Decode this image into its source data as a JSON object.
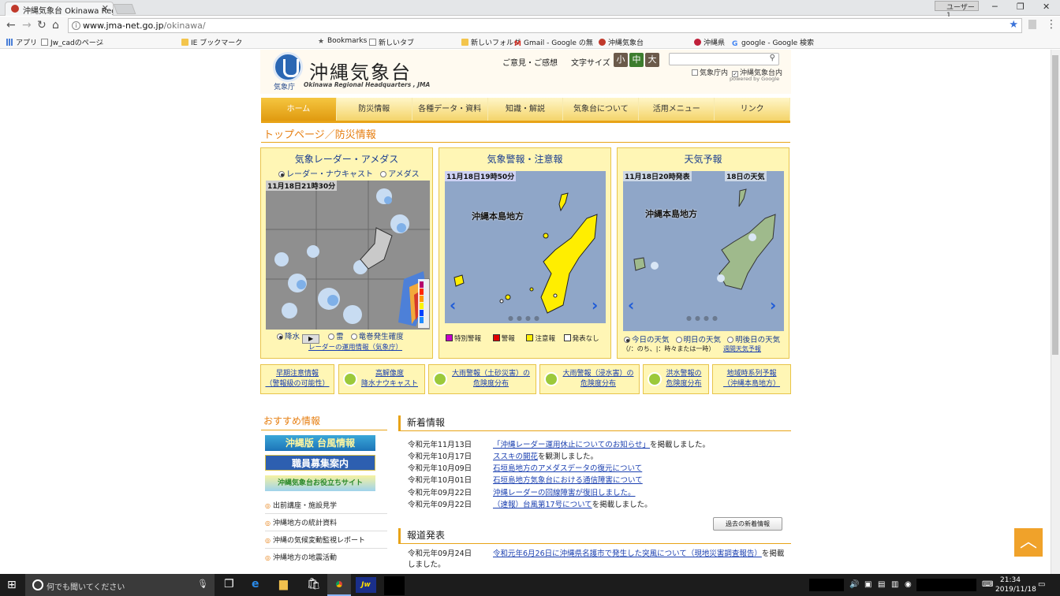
{
  "browser": {
    "tab_title": "沖縄気象台 Okinawa Reg",
    "user_label": "ユーザー 1",
    "url_host": "www.jma-net.go.jp",
    "url_path": "/okinawa/",
    "bookmarks": [
      "アプリ",
      "Jw_cadのページ",
      "_",
      "IE ブックマーク",
      "Bookmarks",
      "新しいタブ",
      "新しいフォルダ",
      "Gmail - Google の無料",
      "沖縄気象台",
      "沖縄県",
      "google - Google 検索"
    ]
  },
  "header": {
    "agency": "気象庁",
    "title": "沖縄気象台",
    "subtitle": "Okinawa Regional Headquarters , JMA",
    "feedback": "ご意見・ご感想",
    "fontsize_label": "文字サイズ",
    "fs_small": "小",
    "fs_medium": "中",
    "fs_large": "大",
    "scope_site": "気象庁内",
    "scope_local": "沖縄気象台内",
    "powered": "powered by Google"
  },
  "menu": [
    "ホーム",
    "防災情報",
    "各種データ・資料",
    "知識・解説",
    "気象台について",
    "活用メニュー",
    "リンク"
  ],
  "breadcrumb": "トップページ／防災情報",
  "panels": {
    "radar": {
      "title": "気象レーダー・アメダス",
      "opt1": "レーダー・ナウキャスト",
      "opt2": "アメダス",
      "timestamp": "11月18日21時30分",
      "r1": "降水",
      "r2": "雷",
      "r3": "竜巻発生確度",
      "link": "レーダーの運用情報（気象庁）"
    },
    "warning": {
      "title": "気象警報・注意報",
      "timestamp": "11月18日19時50分",
      "region": "沖縄本島地方",
      "leg1": "特別警報",
      "leg2": "警報",
      "leg3": "注意報",
      "leg4": "発表なし"
    },
    "forecast": {
      "title": "天気予報",
      "timestamp": "11月18日20時発表",
      "day": "18日の天気",
      "region": "沖縄本島地方",
      "r1": "今日の天気",
      "r2": "明日の天気",
      "r3": "明後日の天気",
      "note": "（/：のち、|：時々または一時）",
      "link": "週間天気予報"
    }
  },
  "linkbuttons": [
    {
      "l1": "早期注意情報",
      "l2": "（警報級の可能性）"
    },
    {
      "l1": "高解像度",
      "l2": "降水ナウキャスト"
    },
    {
      "l1": "大雨警報（土砂災害）の",
      "l2": "危険度分布"
    },
    {
      "l1": "大雨警報（浸水害）の",
      "l2": "危険度分布"
    },
    {
      "l1": "洪水警報の",
      "l2": "危険度分布"
    },
    {
      "l1": "地域時系列予報",
      "l2": "（沖縄本島地方）"
    }
  ],
  "recommend": {
    "title": "おすすめ情報",
    "banner1": "沖縄版 台風情報",
    "banner2": "職員募集案内",
    "banner3": "沖縄気象台お役立ちサイト",
    "links": [
      "出前講座・施設見学",
      "沖縄地方の統計資料",
      "沖縄の気候変動監視レポート",
      "沖縄地方の地震活動"
    ]
  },
  "news": {
    "title": "新着情報",
    "items": [
      {
        "date": "令和元年11月13日",
        "link": "「沖縄レーダー運用休止についてのお知らせ」",
        "rest": "を掲載しました。"
      },
      {
        "date": "令和元年10月17日",
        "link": "ススキの開花",
        "rest": "を観測しました。"
      },
      {
        "date": "令和元年10月09日",
        "link": "石垣島地方のアメダスデータの復元について",
        "rest": ""
      },
      {
        "date": "令和元年10月01日",
        "link": "石垣島地方気象台における通信障害について",
        "rest": ""
      },
      {
        "date": "令和元年09月22日",
        "link": "沖縄レーダーの回線障害が復旧しました。",
        "rest": ""
      },
      {
        "date": "令和元年09月22日",
        "link": "（速報）台風第17号について",
        "rest": "を掲載しました。"
      }
    ],
    "past_button": "過去の新着情報"
  },
  "press": {
    "title": "報道発表",
    "date": "令和元年09月24日",
    "link": "令和元年6月26日に沖縄県名護市で発生した突風について（現地災害調査報告）",
    "rest": "を掲載しました。"
  },
  "taskbar": {
    "search_placeholder": "何でも聞いてください",
    "time": "21:34",
    "date": "2019/11/18"
  },
  "colors": {
    "accent": "#e8a317",
    "panel_bg": "#fff6b5",
    "link": "#1a3fb0",
    "warning_yellow": "#ffee00"
  }
}
